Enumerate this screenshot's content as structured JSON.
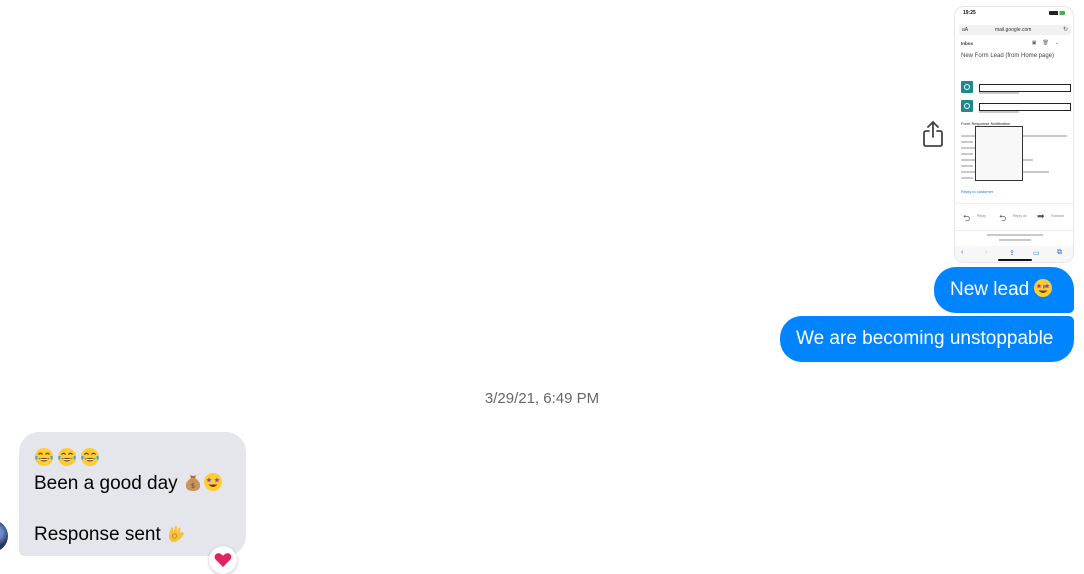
{
  "conversation": {
    "outgoing": [
      {
        "text": "New lead",
        "emoji": "star-struck-emoji"
      },
      {
        "text": "We are becoming unstoppable"
      }
    ],
    "timestamp": "3/29/21, 6:49 PM",
    "incoming": {
      "line1_emojis": [
        "joy-emoji",
        "joy-emoji",
        "joy-emoji"
      ],
      "line2": "Been a good day",
      "line2_emojis": [
        "money-bag-emoji",
        "star-struck-emoji"
      ],
      "line3": "Response sent",
      "line3_emoji": "ok-hand-emoji",
      "reaction": "heart-emoji"
    }
  },
  "attachment": {
    "status_time": "19:25",
    "url_aa": "aA",
    "url": "mail.google.com",
    "inbox_label": "Inbox",
    "subject": "New Form Lead (from Home page)",
    "notification_heading": "Form Response Notification",
    "reply_link": "Reply to customer",
    "actions": [
      "Reply",
      "Reply all",
      "Forward"
    ]
  },
  "colors": {
    "outgoing_bubble": "#0084ff",
    "incoming_bubble": "#e4e6eb",
    "timestamp": "#65676b",
    "reaction_heart": "#e0245e"
  }
}
